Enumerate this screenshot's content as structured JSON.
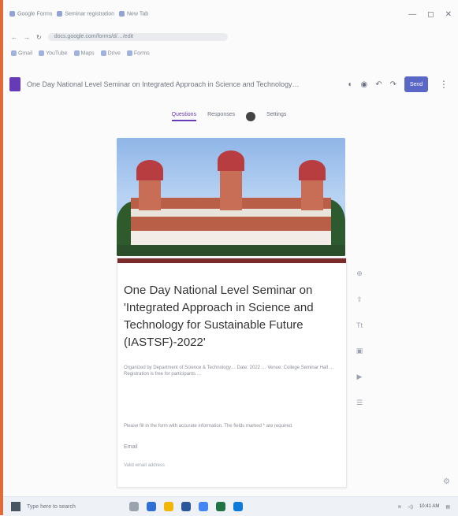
{
  "browser": {
    "tabs": [
      "Google Forms",
      "Seminar registration",
      "New Tab"
    ],
    "window_controls": [
      "—",
      "◻",
      "✕"
    ],
    "address": "docs.google.com/forms/d/…/edit",
    "bookmarks": [
      "Gmail",
      "YouTube",
      "Maps",
      "Drive",
      "Forms"
    ]
  },
  "form": {
    "doc_title": "One Day National Level Seminar on Integrated Approach in Science and Technology…",
    "send_label": "Send",
    "tabs": [
      "Questions",
      "Responses",
      "Settings"
    ],
    "title": "One Day National Level Seminar on 'Integrated Approach in Science and Technology for Sustainable Future (IASTSF)-2022'",
    "description": "Organized by Department of Science & Technology… Date: 2022 … Venue: College Seminar Hall … Registration is free for participants …",
    "subtext": "Please fill in the form with accurate information. The fields marked * are required.",
    "email_label": "Email",
    "email_placeholder": "Valid email address"
  },
  "taskbar": {
    "search_text": "Type here to search",
    "clock": "10:41 AM"
  },
  "colors": {
    "accent_purple": "#673ab7",
    "form_accent": "#7a2b2c",
    "send_button": "#5b67c7"
  }
}
